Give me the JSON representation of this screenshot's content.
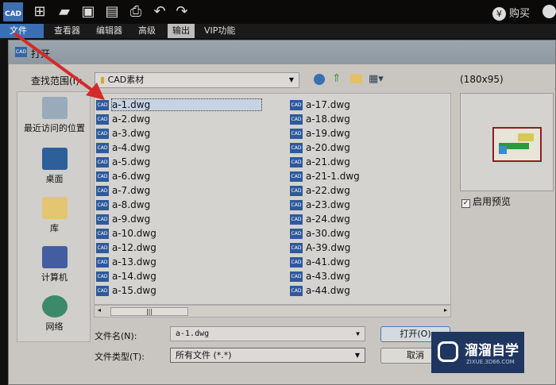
{
  "app": {
    "logo": "CAD",
    "buy_label": "购买",
    "toolbar_icons": [
      "new-icon",
      "open-folder-icon",
      "save-icon",
      "save-pdf-icon",
      "print-icon",
      "undo-icon",
      "redo-icon"
    ]
  },
  "menu": [
    "文件",
    "查看器",
    "编辑器",
    "高级",
    "输出",
    "VIP功能"
  ],
  "dialog": {
    "title": "打开",
    "look_in_label": "查找范围(I):",
    "look_in_value": "CAD素材",
    "places": [
      "最近访问的位置",
      "桌面",
      "库",
      "计算机",
      "网络"
    ],
    "files_col1": [
      "a-1.dwg",
      "a-2.dwg",
      "a-3.dwg",
      "a-4.dwg",
      "a-5.dwg",
      "a-6.dwg",
      "a-7.dwg",
      "a-8.dwg",
      "a-9.dwg",
      "a-10.dwg",
      "a-12.dwg",
      "a-13.dwg",
      "a-14.dwg",
      "a-15.dwg"
    ],
    "files_col2": [
      "a-17.dwg",
      "a-18.dwg",
      "a-19.dwg",
      "a-20.dwg",
      "a-21.dwg",
      "a-21-1.dwg",
      "a-22.dwg",
      "a-23.dwg",
      "a-24.dwg",
      "a-30.dwg",
      "A-39.dwg",
      "a-41.dwg",
      "a-43.dwg",
      "a-44.dwg"
    ],
    "file_icon": "CAD",
    "preview_size": "(180x95)",
    "enable_preview": "启用预览",
    "filename_label": "文件名(N):",
    "filename_value": "a-1.dwg",
    "filetype_label": "文件类型(T):",
    "filetype_value": "所有文件 (*.*)",
    "open_button": "打开(O)",
    "cancel_button": "取消"
  },
  "watermark": {
    "title": "溜溜自学",
    "sub": "ZIXUE.3D66.COM"
  }
}
